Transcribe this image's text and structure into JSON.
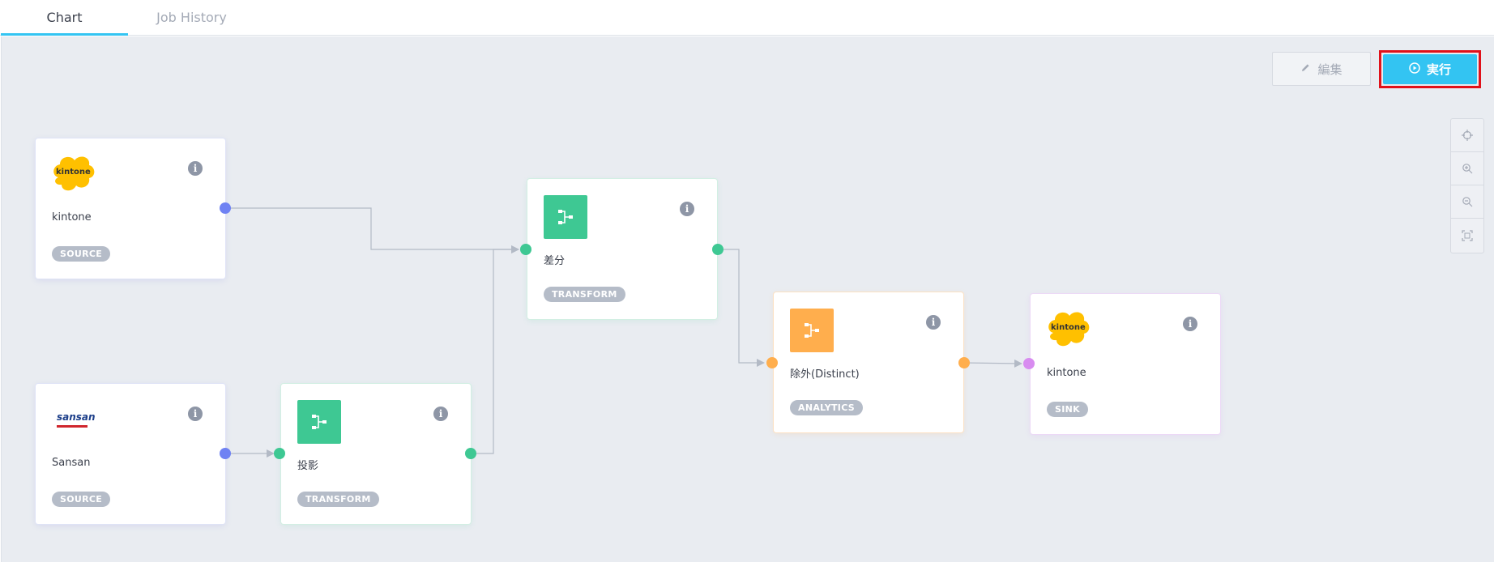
{
  "tabs": [
    {
      "label": "Chart",
      "active": true
    },
    {
      "label": "Job History",
      "active": false
    }
  ],
  "toolbar": {
    "edit_label": "編集",
    "run_label": "実行"
  },
  "zoom_controls": [
    "crosshair-icon",
    "zoom-in-icon",
    "zoom-out-icon",
    "fit-screen-icon"
  ],
  "nodes": [
    {
      "id": "kintone-source",
      "label": "kintone",
      "badge": "SOURCE",
      "icon": "kintone-logo"
    },
    {
      "id": "sansan-source",
      "label": "Sansan",
      "badge": "SOURCE",
      "icon": "sansan-logo",
      "logo_text": "sansan"
    },
    {
      "id": "projection",
      "label": "投影",
      "badge": "TRANSFORM",
      "icon": "branch-icon"
    },
    {
      "id": "diff",
      "label": "差分",
      "badge": "TRANSFORM",
      "icon": "branch-icon"
    },
    {
      "id": "distinct",
      "label": "除外(Distinct)",
      "badge": "ANALYTICS",
      "icon": "branch-icon"
    },
    {
      "id": "kintone-sink",
      "label": "kintone",
      "badge": "SINK",
      "icon": "kintone-logo"
    }
  ],
  "logo_text": {
    "kintone": "kintone"
  },
  "colors": {
    "accent": "#33c4f2",
    "highlight": "#e0111a",
    "source_port": "#6f82f3",
    "transform": "#3ec893",
    "analytics": "#ffae4d",
    "sink_port": "#d88cf0",
    "badge": "#b5bcc8"
  }
}
